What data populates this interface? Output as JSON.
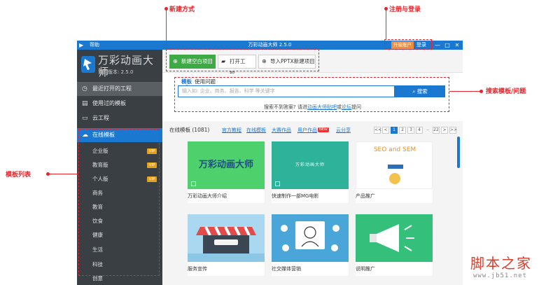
{
  "window": {
    "title": "万彩动画大师 2.5.0",
    "help": "帮助",
    "upgrade": "升级账户",
    "login": "登录",
    "btn_minimize": "—",
    "btn_maximize": "□",
    "btn_close": "✕"
  },
  "brand": {
    "name": "万彩动画大师",
    "version_label": "当前版本: 2.5.0"
  },
  "sidebar": {
    "items": [
      {
        "label": "最近打开的工程"
      },
      {
        "label": "使用过的模板"
      },
      {
        "label": "云工程"
      },
      {
        "label": "在线模板"
      }
    ],
    "sub_items": [
      {
        "label": "企业版",
        "vip": "VIP"
      },
      {
        "label": "教育版",
        "vip": "VIP"
      },
      {
        "label": "个人版",
        "vip": "VIP"
      },
      {
        "label": "商务"
      },
      {
        "label": "教育"
      },
      {
        "label": "饮食"
      },
      {
        "label": "健康"
      },
      {
        "label": "生活"
      },
      {
        "label": "科技"
      },
      {
        "label": "创意"
      }
    ]
  },
  "toolbar": {
    "new_blank": "新建空白项目",
    "open_project": "打开工程...",
    "import_pptx": "导入PPTX新建项目"
  },
  "search": {
    "tab_template": "模板",
    "tab_help": "使用问题",
    "placeholder": "输入如: 企业、商务、报告、科学 等关键字",
    "button": "搜索",
    "tip_prefix": "搜索不到答案? 请进",
    "tip_link1": "动画大师贴吧",
    "tip_mid": "或",
    "tip_link2": "论坛",
    "tip_suffix": "提问"
  },
  "list": {
    "count_label": "在线模板 (1081)",
    "links": [
      "官方教程",
      "在线模板",
      "大赛作品",
      "用户作品",
      "云分享"
    ],
    "new_badge": "NEW",
    "pagination": [
      "<<",
      "<",
      "1",
      "2",
      "3",
      "4",
      "..",
      "22",
      ">",
      ">>"
    ],
    "cards": [
      {
        "label": "万彩动画大师介绍",
        "thumb_text": "万彩动画大师"
      },
      {
        "label": "快速制作一部MG电影",
        "thumb_text": "万彩动画大师"
      },
      {
        "label": "产品推广",
        "thumb_text": "SEO and SEM"
      },
      {
        "label": "服务宣传",
        "thumb_text": ""
      },
      {
        "label": "社交媒体营销",
        "thumb_text": ""
      },
      {
        "label": "说明推广",
        "thumb_text": ""
      }
    ]
  },
  "annotations": {
    "new_method": "新建方式",
    "register_login": "注册与登录",
    "search_help": "搜索模板/问题",
    "template_list": "模板列表"
  },
  "watermark": {
    "title": "脚本之家",
    "url": "www.jb51.net"
  },
  "colors": {
    "accent": "#1b78d1",
    "sidebar": "#3a3f44",
    "green": "#3daa46",
    "annotation": "#e8252b",
    "vip": "#e7a21a"
  }
}
